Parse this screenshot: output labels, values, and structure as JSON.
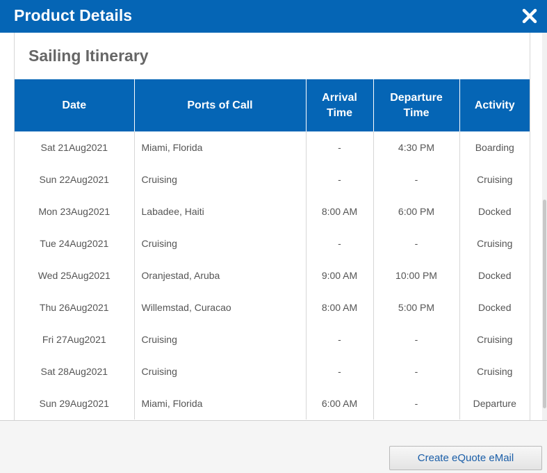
{
  "modal": {
    "title": "Product Details",
    "close_icon": "close-icon"
  },
  "itinerary": {
    "section_title": "Sailing Itinerary",
    "columns": [
      "Date",
      "Ports of Call",
      "Arrival Time",
      "Departure Time",
      "Activity"
    ],
    "rows": [
      {
        "date": "Sat 21Aug2021",
        "port": "Miami, Florida",
        "arrival": "-",
        "departure": "4:30 PM",
        "activity": "Boarding"
      },
      {
        "date": "Sun 22Aug2021",
        "port": "Cruising",
        "arrival": "-",
        "departure": "-",
        "activity": "Cruising"
      },
      {
        "date": "Mon 23Aug2021",
        "port": "Labadee, Haiti",
        "arrival": "8:00 AM",
        "departure": "6:00 PM",
        "activity": "Docked"
      },
      {
        "date": "Tue 24Aug2021",
        "port": "Cruising",
        "arrival": "-",
        "departure": "-",
        "activity": "Cruising"
      },
      {
        "date": "Wed 25Aug2021",
        "port": "Oranjestad, Aruba",
        "arrival": "9:00 AM",
        "departure": "10:00 PM",
        "activity": "Docked"
      },
      {
        "date": "Thu 26Aug2021",
        "port": "Willemstad, Curacao",
        "arrival": "8:00 AM",
        "departure": "5:00 PM",
        "activity": "Docked"
      },
      {
        "date": "Fri 27Aug2021",
        "port": "Cruising",
        "arrival": "-",
        "departure": "-",
        "activity": "Cruising"
      },
      {
        "date": "Sat 28Aug2021",
        "port": "Cruising",
        "arrival": "-",
        "departure": "-",
        "activity": "Cruising"
      },
      {
        "date": "Sun 29Aug2021",
        "port": "Miami, Florida",
        "arrival": "6:00 AM",
        "departure": "-",
        "activity": "Departure"
      }
    ]
  },
  "footer": {
    "equote_label": "Create eQuote eMail"
  },
  "colors": {
    "header_blue": "#0565b5",
    "link_blue": "#1a5ea8"
  }
}
